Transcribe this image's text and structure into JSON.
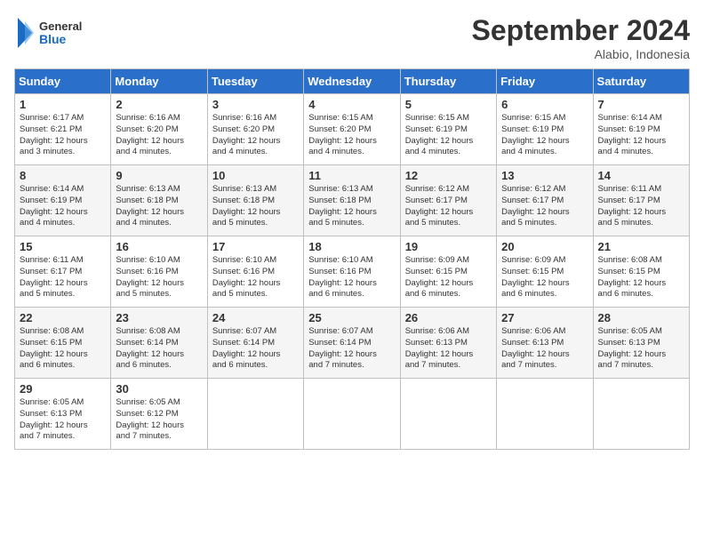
{
  "logo": {
    "line1": "General",
    "line2": "Blue"
  },
  "title": "September 2024",
  "subtitle": "Alabio, Indonesia",
  "days_header": [
    "Sunday",
    "Monday",
    "Tuesday",
    "Wednesday",
    "Thursday",
    "Friday",
    "Saturday"
  ],
  "weeks": [
    [
      {
        "day": "1",
        "info": "Sunrise: 6:17 AM\nSunset: 6:21 PM\nDaylight: 12 hours\nand 3 minutes."
      },
      {
        "day": "2",
        "info": "Sunrise: 6:16 AM\nSunset: 6:20 PM\nDaylight: 12 hours\nand 4 minutes."
      },
      {
        "day": "3",
        "info": "Sunrise: 6:16 AM\nSunset: 6:20 PM\nDaylight: 12 hours\nand 4 minutes."
      },
      {
        "day": "4",
        "info": "Sunrise: 6:15 AM\nSunset: 6:20 PM\nDaylight: 12 hours\nand 4 minutes."
      },
      {
        "day": "5",
        "info": "Sunrise: 6:15 AM\nSunset: 6:19 PM\nDaylight: 12 hours\nand 4 minutes."
      },
      {
        "day": "6",
        "info": "Sunrise: 6:15 AM\nSunset: 6:19 PM\nDaylight: 12 hours\nand 4 minutes."
      },
      {
        "day": "7",
        "info": "Sunrise: 6:14 AM\nSunset: 6:19 PM\nDaylight: 12 hours\nand 4 minutes."
      }
    ],
    [
      {
        "day": "8",
        "info": "Sunrise: 6:14 AM\nSunset: 6:19 PM\nDaylight: 12 hours\nand 4 minutes."
      },
      {
        "day": "9",
        "info": "Sunrise: 6:13 AM\nSunset: 6:18 PM\nDaylight: 12 hours\nand 4 minutes."
      },
      {
        "day": "10",
        "info": "Sunrise: 6:13 AM\nSunset: 6:18 PM\nDaylight: 12 hours\nand 5 minutes."
      },
      {
        "day": "11",
        "info": "Sunrise: 6:13 AM\nSunset: 6:18 PM\nDaylight: 12 hours\nand 5 minutes."
      },
      {
        "day": "12",
        "info": "Sunrise: 6:12 AM\nSunset: 6:17 PM\nDaylight: 12 hours\nand 5 minutes."
      },
      {
        "day": "13",
        "info": "Sunrise: 6:12 AM\nSunset: 6:17 PM\nDaylight: 12 hours\nand 5 minutes."
      },
      {
        "day": "14",
        "info": "Sunrise: 6:11 AM\nSunset: 6:17 PM\nDaylight: 12 hours\nand 5 minutes."
      }
    ],
    [
      {
        "day": "15",
        "info": "Sunrise: 6:11 AM\nSunset: 6:17 PM\nDaylight: 12 hours\nand 5 minutes."
      },
      {
        "day": "16",
        "info": "Sunrise: 6:10 AM\nSunset: 6:16 PM\nDaylight: 12 hours\nand 5 minutes."
      },
      {
        "day": "17",
        "info": "Sunrise: 6:10 AM\nSunset: 6:16 PM\nDaylight: 12 hours\nand 5 minutes."
      },
      {
        "day": "18",
        "info": "Sunrise: 6:10 AM\nSunset: 6:16 PM\nDaylight: 12 hours\nand 6 minutes."
      },
      {
        "day": "19",
        "info": "Sunrise: 6:09 AM\nSunset: 6:15 PM\nDaylight: 12 hours\nand 6 minutes."
      },
      {
        "day": "20",
        "info": "Sunrise: 6:09 AM\nSunset: 6:15 PM\nDaylight: 12 hours\nand 6 minutes."
      },
      {
        "day": "21",
        "info": "Sunrise: 6:08 AM\nSunset: 6:15 PM\nDaylight: 12 hours\nand 6 minutes."
      }
    ],
    [
      {
        "day": "22",
        "info": "Sunrise: 6:08 AM\nSunset: 6:15 PM\nDaylight: 12 hours\nand 6 minutes."
      },
      {
        "day": "23",
        "info": "Sunrise: 6:08 AM\nSunset: 6:14 PM\nDaylight: 12 hours\nand 6 minutes."
      },
      {
        "day": "24",
        "info": "Sunrise: 6:07 AM\nSunset: 6:14 PM\nDaylight: 12 hours\nand 6 minutes."
      },
      {
        "day": "25",
        "info": "Sunrise: 6:07 AM\nSunset: 6:14 PM\nDaylight: 12 hours\nand 7 minutes."
      },
      {
        "day": "26",
        "info": "Sunrise: 6:06 AM\nSunset: 6:13 PM\nDaylight: 12 hours\nand 7 minutes."
      },
      {
        "day": "27",
        "info": "Sunrise: 6:06 AM\nSunset: 6:13 PM\nDaylight: 12 hours\nand 7 minutes."
      },
      {
        "day": "28",
        "info": "Sunrise: 6:05 AM\nSunset: 6:13 PM\nDaylight: 12 hours\nand 7 minutes."
      }
    ],
    [
      {
        "day": "29",
        "info": "Sunrise: 6:05 AM\nSunset: 6:13 PM\nDaylight: 12 hours\nand 7 minutes."
      },
      {
        "day": "30",
        "info": "Sunrise: 6:05 AM\nSunset: 6:12 PM\nDaylight: 12 hours\nand 7 minutes."
      },
      {
        "day": "",
        "info": ""
      },
      {
        "day": "",
        "info": ""
      },
      {
        "day": "",
        "info": ""
      },
      {
        "day": "",
        "info": ""
      },
      {
        "day": "",
        "info": ""
      }
    ]
  ]
}
